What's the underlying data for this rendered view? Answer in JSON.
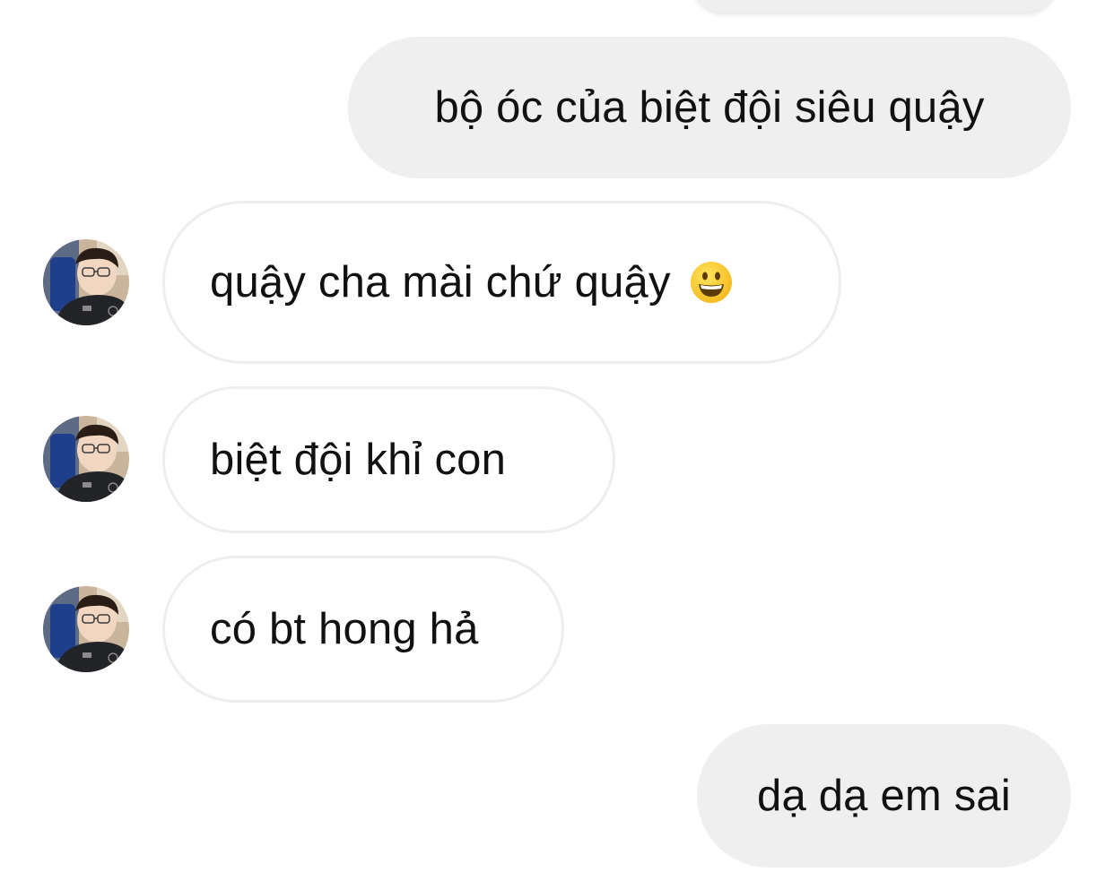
{
  "conversation": {
    "messages": [
      {
        "sender": "me",
        "text": "bộ óc của biệt đội siêu quậy"
      },
      {
        "sender": "contact",
        "text": "quậy cha mài chứ quậy",
        "emoji": "grinning-face-emoji"
      },
      {
        "sender": "contact",
        "text": "biệt đội khỉ con"
      },
      {
        "sender": "contact",
        "text": "có bt hong hả"
      },
      {
        "sender": "me",
        "text": "dạ dạ em sai"
      }
    ]
  },
  "colors": {
    "outgoing_bubble": "#efefef",
    "incoming_bubble_border": "#eeeeee",
    "background": "#ffffff",
    "text": "#111111"
  }
}
